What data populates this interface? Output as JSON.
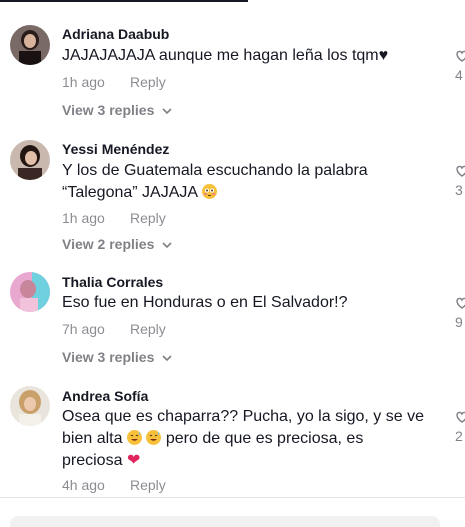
{
  "comments": [
    {
      "username": "Adriana Daabub",
      "text": "JAJAJAJAJA aunque me hagan leña los tqm♥",
      "time": "1h ago",
      "reply_label": "Reply",
      "view_replies": "View 3 replies",
      "like_count": "4"
    },
    {
      "username": "Yessi Menéndez",
      "text_line1": "Y los de Guatemala escuchando la palabra",
      "text_line2": "“Talegona” JAJAJA",
      "time": "1h ago",
      "reply_label": "Reply",
      "view_replies": "View 2 replies",
      "like_count": "3"
    },
    {
      "username": "Thalia Corrales",
      "text": "Eso fue en Honduras o en El Salvador!?",
      "time": "7h ago",
      "reply_label": "Reply",
      "view_replies": "View 3 replies",
      "like_count": "9"
    },
    {
      "username": "Andrea Sofía",
      "text_line1": "Osea que es chaparra?? Pucha, yo la sigo, y se ve",
      "text_line2_a": "bien alta",
      "text_line2_b": "pero de que es preciosa, es",
      "text_line3": "preciosa",
      "time": "4h ago",
      "reply_label": "Reply",
      "like_count": "2"
    }
  ],
  "icons": {
    "like": "heart-outline-icon",
    "chevron": "chevron-down-icon"
  },
  "colors": {
    "text_primary": "#161823",
    "text_secondary": "#8a8b91",
    "emoji_heart": "#e0245e"
  }
}
